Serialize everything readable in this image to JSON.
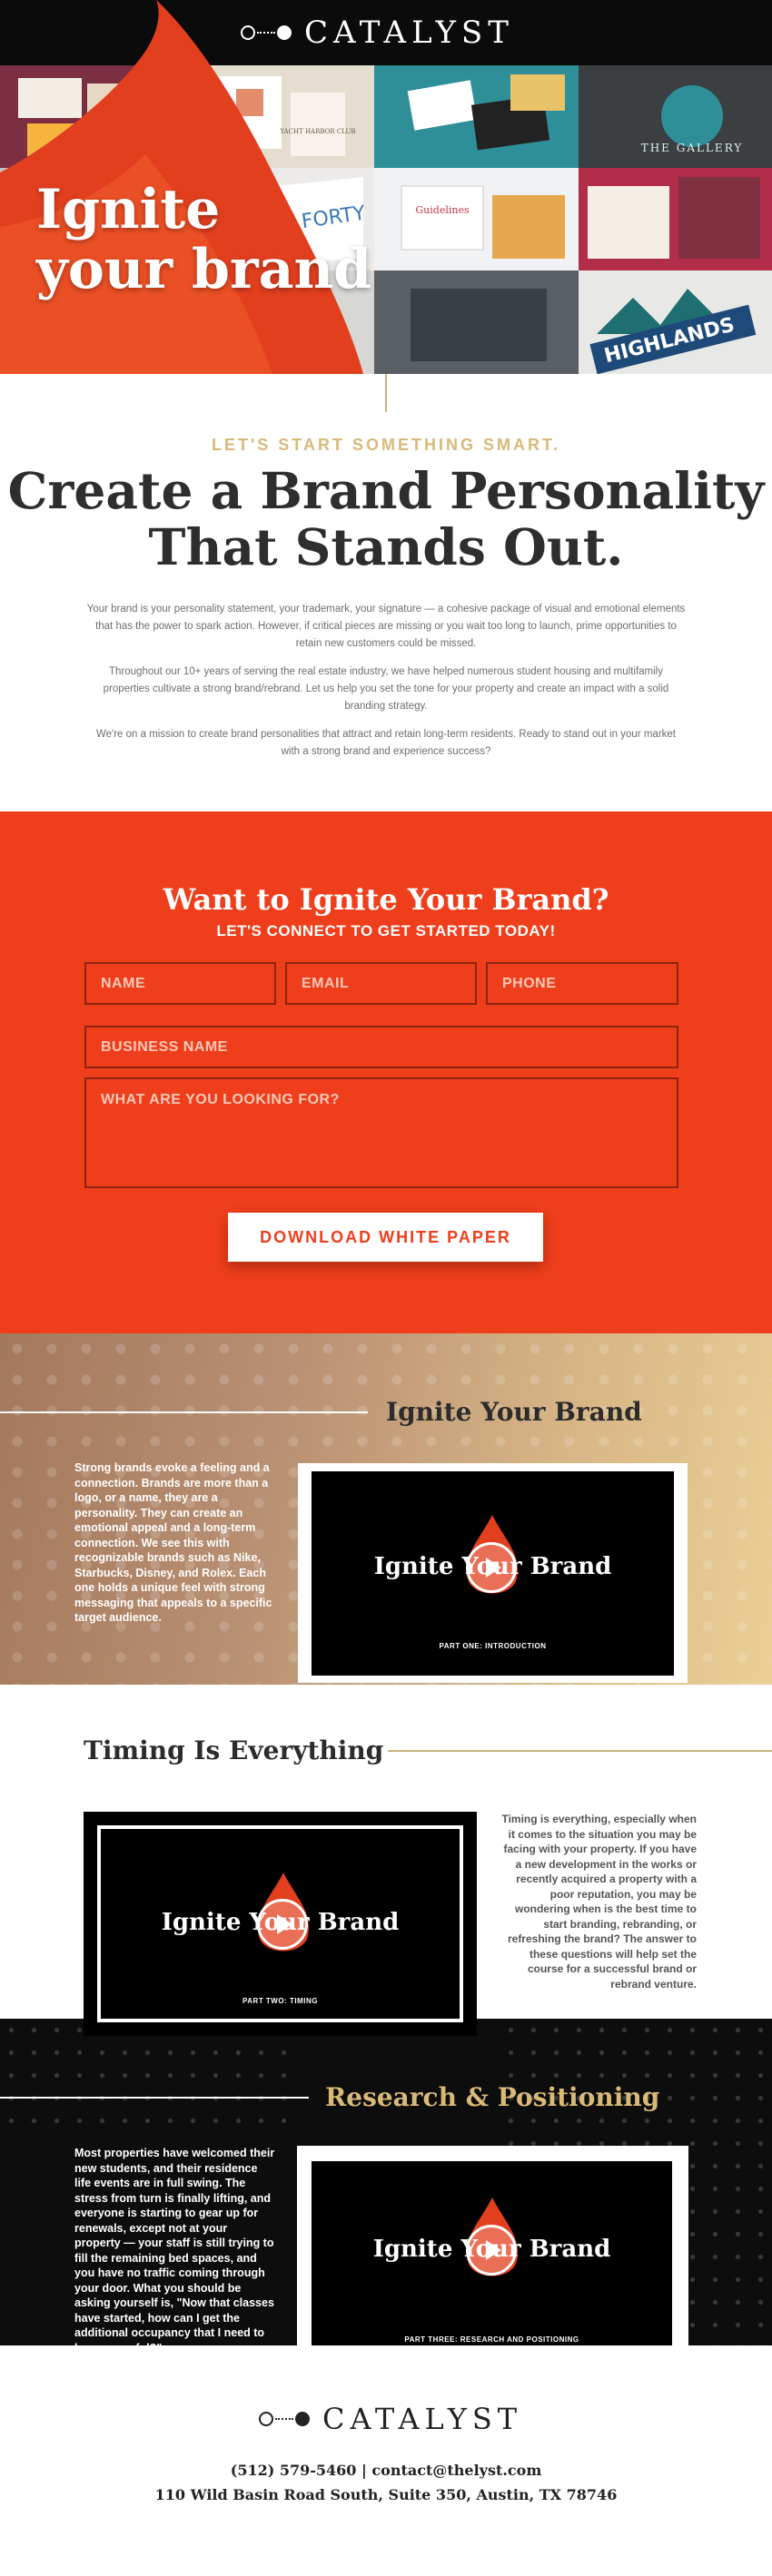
{
  "brand": {
    "name": "CATALYST",
    "accent": "#ef3e1b",
    "gold": "#d8b978"
  },
  "hero": {
    "title_line1": "Ignite",
    "title_line2": "your brand",
    "tiles": [
      "YACHT HARBOR CLUB",
      "THE GALLERY",
      "THE EIGHT FORTY",
      "HIGHLANDS",
      "Guidelines"
    ]
  },
  "intro": {
    "kicker": "LET'S START SOMETHING SMART.",
    "headline_line1": "Create a Brand Personality",
    "headline_line2": "That Stands Out.",
    "paragraphs": [
      "Your brand is your personality statement, your trademark, your signature — a cohesive package of visual and emotional elements that has the power to spark action. However, if critical pieces are missing or you wait too long to launch, prime opportunities to retain new customers could be missed.",
      "Throughout our 10+ years of serving the real estate industry, we have helped numerous student housing and multifamily properties cultivate a strong brand/rebrand. Let us help you set the tone for your property and create an impact with a solid branding strategy.",
      "We're on a mission to create brand personalities that attract and retain long-term residents. Ready to stand out in your market with a strong brand and experience success?"
    ]
  },
  "form": {
    "title": "Want to Ignite Your Brand?",
    "subtitle": "LET'S CONNECT TO GET STARTED TODAY!",
    "name_placeholder": "NAME",
    "email_placeholder": "EMAIL",
    "phone_placeholder": "PHONE",
    "business_placeholder": "BUSINESS NAME",
    "message_placeholder": "WHAT ARE YOU LOOKING FOR?",
    "submit_label": "DOWNLOAD WHITE PAPER"
  },
  "videos": {
    "title": "Ignite Your Brand",
    "ignite": {
      "heading": "Ignite Your Brand",
      "blurb": "Strong brands evoke a feeling and a connection. Brands are more than a logo, or a name, they are a personality. They can create an emotional appeal and a long-term connection. We see this with recognizable brands such as Nike, Starbucks, Disney, and Rolex. Each one holds a unique feel with strong messaging that appeals to a specific target audience.",
      "part": "PART ONE: INTRODUCTION"
    },
    "timing": {
      "heading": "Timing Is Everything",
      "blurb": "Timing is everything, especially when it comes to the situation you may be facing with your property. If you have a new development in the works or recently acquired a property with a poor reputation, you may be wondering when is the best time to start branding, rebranding, or refreshing the brand? The answer to these questions will help set the course for a successful brand or rebrand venture.",
      "part": "PART TWO: TIMING"
    },
    "research": {
      "heading": "Research & Positioning",
      "blurb": "Most properties have welcomed their new students, and their residence life events are in full swing. The stress from turn is finally lifting, and everyone is starting to gear up for renewals, except not at your property — your staff is still trying to fill the remaining bed spaces, and you have no traffic coming through your door. What you should be asking yourself is, \"Now that classes have started, how can I get the additional occupancy that I need to be successful?\"",
      "part": "PART THREE: RESEARCH AND POSITIONING"
    }
  },
  "footer": {
    "phone": "(512) 579-5460",
    "separator": "|",
    "email": "contact@thelyst.com",
    "address": "110 Wild Basin Road South, Suite 350, Austin, TX 78746"
  }
}
